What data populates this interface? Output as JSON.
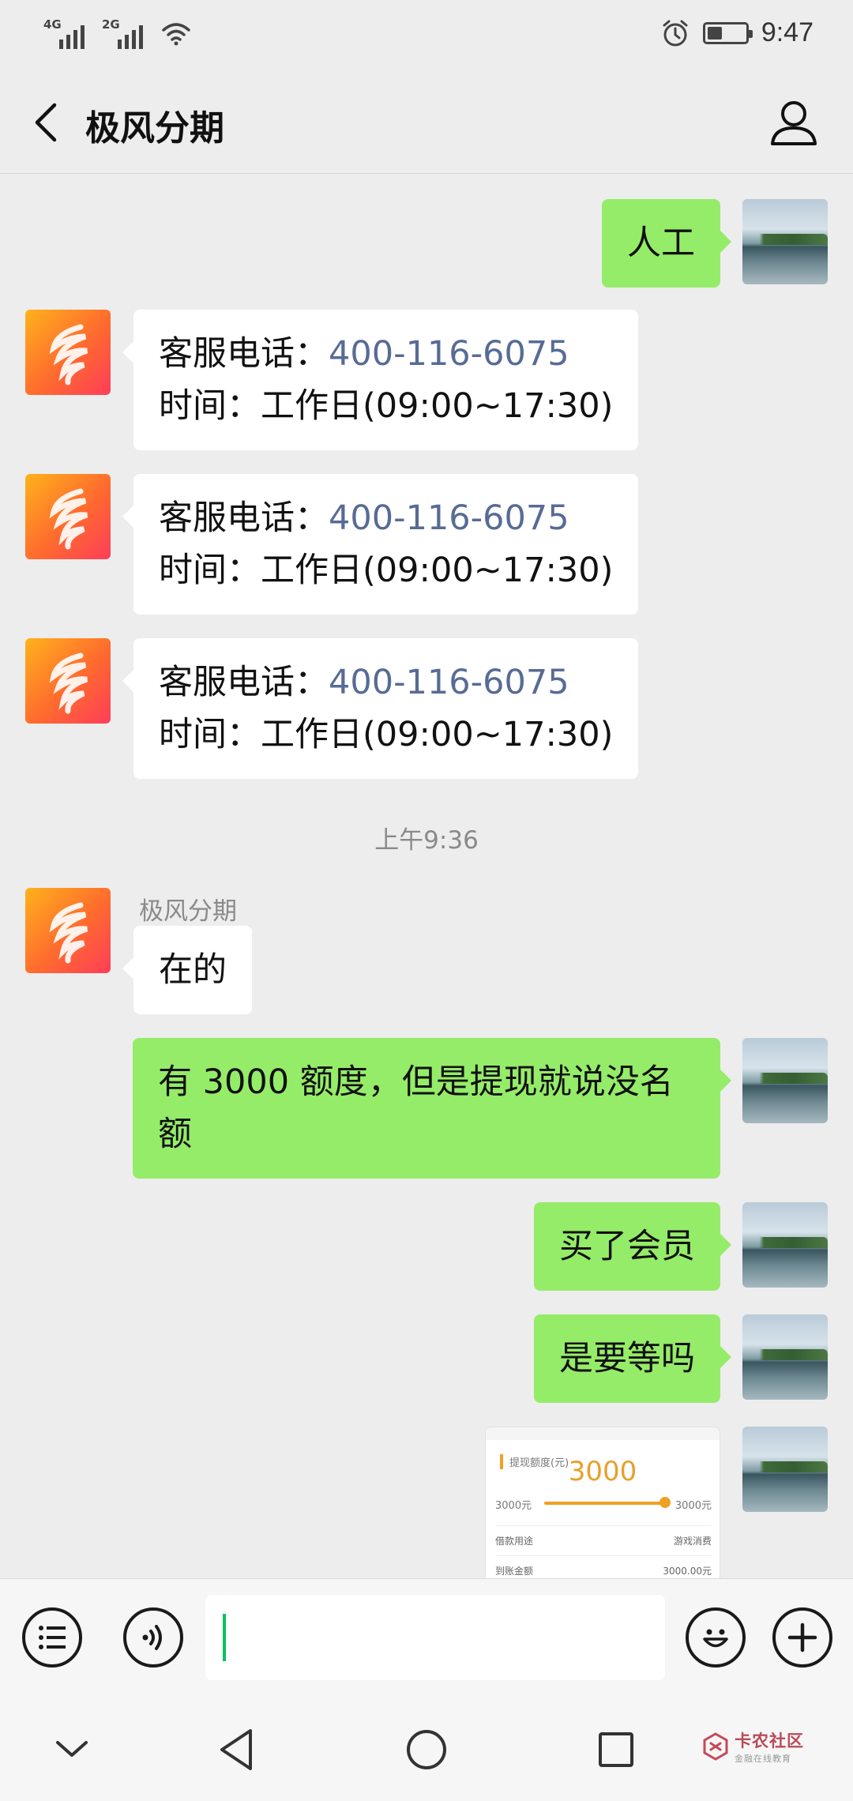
{
  "status_bar": {
    "network1": "4G",
    "network2": "2G",
    "time": "9:47",
    "battery_level": 0.4
  },
  "header": {
    "title": "极风分期",
    "back_icon": "chevron-left-icon",
    "profile_icon": "person-icon"
  },
  "chat": {
    "bot_name": "极风分期",
    "timestamp": "上午9:36",
    "messages": [
      {
        "from": "me",
        "text": "人工"
      },
      {
        "from": "bot",
        "line1_label": "客服电话：",
        "phone": "400-116-6075",
        "line2": "时间：工作日(09:00~17:30)"
      },
      {
        "from": "bot",
        "line1_label": "客服电话：",
        "phone": "400-116-6075",
        "line2": "时间：工作日(09:00~17:30)"
      },
      {
        "from": "bot",
        "line1_label": "客服电话：",
        "phone": "400-116-6075",
        "line2": "时间：工作日(09:00~17:30)"
      },
      {
        "from": "bot",
        "text": "在的"
      },
      {
        "from": "me",
        "line1": "有 3000 额度，但是提现就说没名",
        "line2": "额"
      },
      {
        "from": "me",
        "text": "买了会员"
      },
      {
        "from": "me",
        "text": "是要等吗"
      }
    ],
    "image_message": {
      "label": "提现额度(元)",
      "amount": "3000",
      "min": "3000元",
      "max": "3000元",
      "slider_fraction": 1.0,
      "row1_label": "借款用途",
      "row1_value": "游戏消费",
      "row2_label": "到账金额",
      "row2_value": "3000.00元"
    }
  },
  "input_bar": {
    "menu_icon": "list-menu-icon",
    "voice_icon": "voice-icon",
    "emoji_icon": "emoji-icon",
    "plus_icon": "plus-icon",
    "input_value": ""
  },
  "nav_bar": {
    "down_icon": "chevron-down-icon",
    "back_icon": "triangle-back-icon",
    "home_icon": "circle-home-icon",
    "recent_icon": "square-recent-icon",
    "watermark_title": "卡农社区",
    "watermark_sub": "金融在线教育"
  },
  "colors": {
    "my_bubble": "#95ec69",
    "bot_bubble": "#ffffff",
    "phone_link": "#576b95",
    "background": "#ededed",
    "cursor": "#07c160"
  }
}
